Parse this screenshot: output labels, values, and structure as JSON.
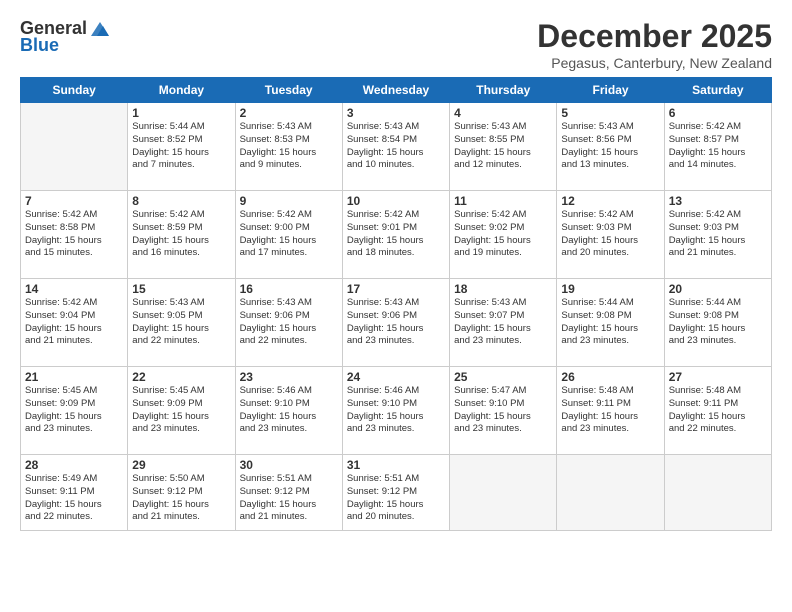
{
  "header": {
    "logo_general": "General",
    "logo_blue": "Blue",
    "title": "December 2025",
    "location": "Pegasus, Canterbury, New Zealand"
  },
  "days_of_week": [
    "Sunday",
    "Monday",
    "Tuesday",
    "Wednesday",
    "Thursday",
    "Friday",
    "Saturday"
  ],
  "weeks": [
    [
      {
        "day": "",
        "empty": true,
        "lines": []
      },
      {
        "day": "1",
        "empty": false,
        "lines": [
          "Sunrise: 5:44 AM",
          "Sunset: 8:52 PM",
          "Daylight: 15 hours",
          "and 7 minutes."
        ]
      },
      {
        "day": "2",
        "empty": false,
        "lines": [
          "Sunrise: 5:43 AM",
          "Sunset: 8:53 PM",
          "Daylight: 15 hours",
          "and 9 minutes."
        ]
      },
      {
        "day": "3",
        "empty": false,
        "lines": [
          "Sunrise: 5:43 AM",
          "Sunset: 8:54 PM",
          "Daylight: 15 hours",
          "and 10 minutes."
        ]
      },
      {
        "day": "4",
        "empty": false,
        "lines": [
          "Sunrise: 5:43 AM",
          "Sunset: 8:55 PM",
          "Daylight: 15 hours",
          "and 12 minutes."
        ]
      },
      {
        "day": "5",
        "empty": false,
        "lines": [
          "Sunrise: 5:43 AM",
          "Sunset: 8:56 PM",
          "Daylight: 15 hours",
          "and 13 minutes."
        ]
      },
      {
        "day": "6",
        "empty": false,
        "lines": [
          "Sunrise: 5:42 AM",
          "Sunset: 8:57 PM",
          "Daylight: 15 hours",
          "and 14 minutes."
        ]
      }
    ],
    [
      {
        "day": "7",
        "empty": false,
        "lines": [
          "Sunrise: 5:42 AM",
          "Sunset: 8:58 PM",
          "Daylight: 15 hours",
          "and 15 minutes."
        ]
      },
      {
        "day": "8",
        "empty": false,
        "lines": [
          "Sunrise: 5:42 AM",
          "Sunset: 8:59 PM",
          "Daylight: 15 hours",
          "and 16 minutes."
        ]
      },
      {
        "day": "9",
        "empty": false,
        "lines": [
          "Sunrise: 5:42 AM",
          "Sunset: 9:00 PM",
          "Daylight: 15 hours",
          "and 17 minutes."
        ]
      },
      {
        "day": "10",
        "empty": false,
        "lines": [
          "Sunrise: 5:42 AM",
          "Sunset: 9:01 PM",
          "Daylight: 15 hours",
          "and 18 minutes."
        ]
      },
      {
        "day": "11",
        "empty": false,
        "lines": [
          "Sunrise: 5:42 AM",
          "Sunset: 9:02 PM",
          "Daylight: 15 hours",
          "and 19 minutes."
        ]
      },
      {
        "day": "12",
        "empty": false,
        "lines": [
          "Sunrise: 5:42 AM",
          "Sunset: 9:03 PM",
          "Daylight: 15 hours",
          "and 20 minutes."
        ]
      },
      {
        "day": "13",
        "empty": false,
        "lines": [
          "Sunrise: 5:42 AM",
          "Sunset: 9:03 PM",
          "Daylight: 15 hours",
          "and 21 minutes."
        ]
      }
    ],
    [
      {
        "day": "14",
        "empty": false,
        "lines": [
          "Sunrise: 5:42 AM",
          "Sunset: 9:04 PM",
          "Daylight: 15 hours",
          "and 21 minutes."
        ]
      },
      {
        "day": "15",
        "empty": false,
        "lines": [
          "Sunrise: 5:43 AM",
          "Sunset: 9:05 PM",
          "Daylight: 15 hours",
          "and 22 minutes."
        ]
      },
      {
        "day": "16",
        "empty": false,
        "lines": [
          "Sunrise: 5:43 AM",
          "Sunset: 9:06 PM",
          "Daylight: 15 hours",
          "and 22 minutes."
        ]
      },
      {
        "day": "17",
        "empty": false,
        "lines": [
          "Sunrise: 5:43 AM",
          "Sunset: 9:06 PM",
          "Daylight: 15 hours",
          "and 23 minutes."
        ]
      },
      {
        "day": "18",
        "empty": false,
        "lines": [
          "Sunrise: 5:43 AM",
          "Sunset: 9:07 PM",
          "Daylight: 15 hours",
          "and 23 minutes."
        ]
      },
      {
        "day": "19",
        "empty": false,
        "lines": [
          "Sunrise: 5:44 AM",
          "Sunset: 9:08 PM",
          "Daylight: 15 hours",
          "and 23 minutes."
        ]
      },
      {
        "day": "20",
        "empty": false,
        "lines": [
          "Sunrise: 5:44 AM",
          "Sunset: 9:08 PM",
          "Daylight: 15 hours",
          "and 23 minutes."
        ]
      }
    ],
    [
      {
        "day": "21",
        "empty": false,
        "lines": [
          "Sunrise: 5:45 AM",
          "Sunset: 9:09 PM",
          "Daylight: 15 hours",
          "and 23 minutes."
        ]
      },
      {
        "day": "22",
        "empty": false,
        "lines": [
          "Sunrise: 5:45 AM",
          "Sunset: 9:09 PM",
          "Daylight: 15 hours",
          "and 23 minutes."
        ]
      },
      {
        "day": "23",
        "empty": false,
        "lines": [
          "Sunrise: 5:46 AM",
          "Sunset: 9:10 PM",
          "Daylight: 15 hours",
          "and 23 minutes."
        ]
      },
      {
        "day": "24",
        "empty": false,
        "lines": [
          "Sunrise: 5:46 AM",
          "Sunset: 9:10 PM",
          "Daylight: 15 hours",
          "and 23 minutes."
        ]
      },
      {
        "day": "25",
        "empty": false,
        "lines": [
          "Sunrise: 5:47 AM",
          "Sunset: 9:10 PM",
          "Daylight: 15 hours",
          "and 23 minutes."
        ]
      },
      {
        "day": "26",
        "empty": false,
        "lines": [
          "Sunrise: 5:48 AM",
          "Sunset: 9:11 PM",
          "Daylight: 15 hours",
          "and 23 minutes."
        ]
      },
      {
        "day": "27",
        "empty": false,
        "lines": [
          "Sunrise: 5:48 AM",
          "Sunset: 9:11 PM",
          "Daylight: 15 hours",
          "and 22 minutes."
        ]
      }
    ],
    [
      {
        "day": "28",
        "empty": false,
        "lines": [
          "Sunrise: 5:49 AM",
          "Sunset: 9:11 PM",
          "Daylight: 15 hours",
          "and 22 minutes."
        ]
      },
      {
        "day": "29",
        "empty": false,
        "lines": [
          "Sunrise: 5:50 AM",
          "Sunset: 9:12 PM",
          "Daylight: 15 hours",
          "and 21 minutes."
        ]
      },
      {
        "day": "30",
        "empty": false,
        "lines": [
          "Sunrise: 5:51 AM",
          "Sunset: 9:12 PM",
          "Daylight: 15 hours",
          "and 21 minutes."
        ]
      },
      {
        "day": "31",
        "empty": false,
        "lines": [
          "Sunrise: 5:51 AM",
          "Sunset: 9:12 PM",
          "Daylight: 15 hours",
          "and 20 minutes."
        ]
      },
      {
        "day": "",
        "empty": true,
        "lines": []
      },
      {
        "day": "",
        "empty": true,
        "lines": []
      },
      {
        "day": "",
        "empty": true,
        "lines": []
      }
    ]
  ]
}
